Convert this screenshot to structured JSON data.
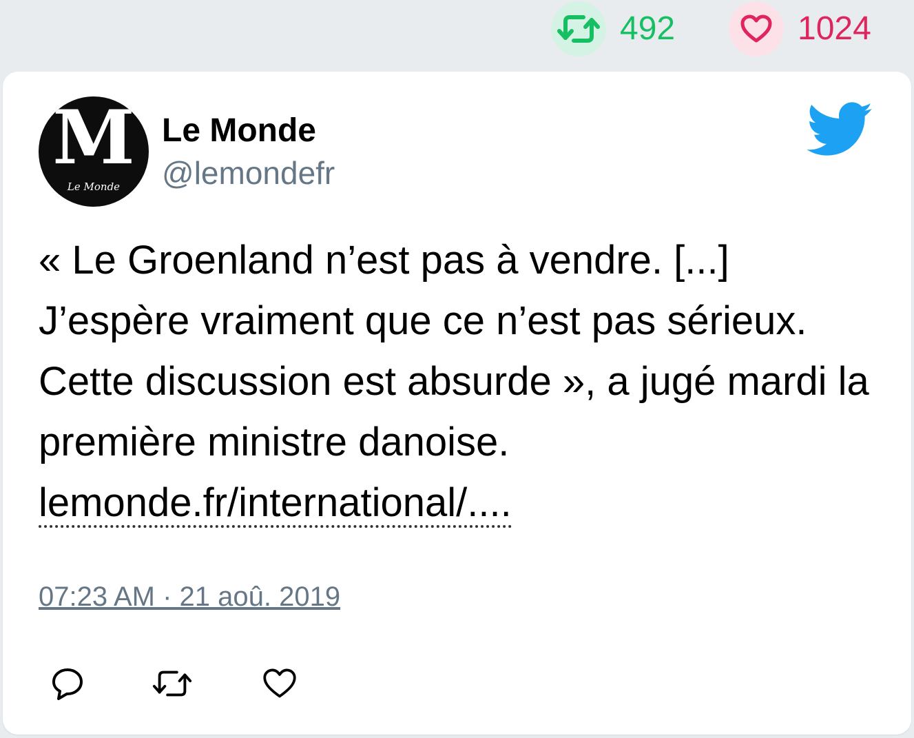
{
  "stats": {
    "retweets": "492",
    "likes": "1024"
  },
  "tweet": {
    "display_name": "Le Monde",
    "handle": "@lemondefr",
    "avatar_letter": "M",
    "avatar_caption": "Le Monde",
    "text": "« Le Groenland n’est pas à vendre. [...] J’espère vraiment que ce n’est pas sérieux. Cette discussion est absurde », a jugé mardi la première ministre danoise.",
    "link_text": "lemonde.fr/international/....",
    "timestamp": "07:23 AM · 21 aoû. 2019"
  },
  "icons": {
    "stats_retweet": "retweet-icon",
    "stats_like": "heart-icon",
    "brand": "twitter-bird-icon",
    "reply": "reply-icon",
    "retweet": "retweet-icon",
    "like": "heart-icon"
  },
  "colors": {
    "twitter_blue": "#1da1f2",
    "retweet_green": "#17bf63",
    "like_red": "#e0245e",
    "muted_text": "#657786"
  }
}
